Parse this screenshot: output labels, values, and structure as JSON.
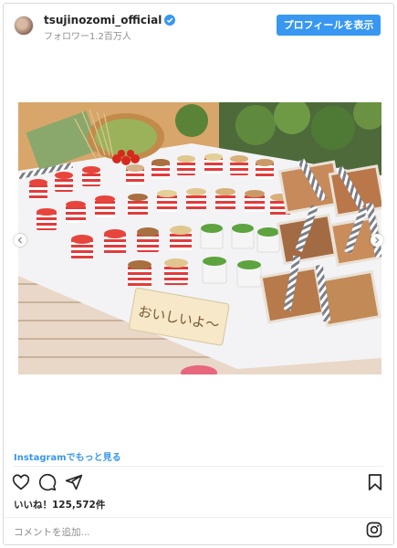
{
  "header": {
    "username": "tsujinozomi_official",
    "followers": "フォロワー1.2百万人",
    "profile_button": "プロフィールを表示"
  },
  "post": {
    "photo_icon": "photo-image",
    "sign_text": "おいしいよ〜"
  },
  "footer": {
    "more_link": "Instagramでもっと見る",
    "likes": "いいね！125,572件",
    "comment_placeholder": "コメントを追加...",
    "icons": [
      "heart-icon",
      "comment-icon",
      "share-icon",
      "bookmark-icon",
      "instagram-icon"
    ]
  },
  "colors": {
    "accent": "#3897f0",
    "text": "#262626",
    "muted": "#8e8e8e"
  }
}
